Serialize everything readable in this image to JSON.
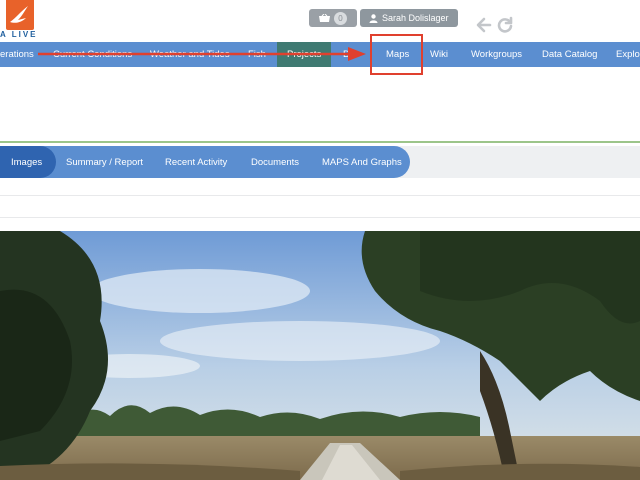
{
  "header": {
    "logo_text": "A LIVE",
    "cart": {
      "count": "0"
    },
    "user": {
      "name": "Sarah Dolislager"
    }
  },
  "main_nav": {
    "items": [
      {
        "label": "erations"
      },
      {
        "label": "Current Conditions"
      },
      {
        "label": "Weather and Tides"
      },
      {
        "label": "Fish"
      },
      {
        "label": "Projects"
      },
      {
        "label": "D"
      },
      {
        "label": "Maps"
      },
      {
        "label": "Wiki"
      },
      {
        "label": "Workgroups"
      },
      {
        "label": "Data Catalog"
      },
      {
        "label": "Explor"
      }
    ]
  },
  "sub_tabs": {
    "items": [
      {
        "label": "Images"
      },
      {
        "label": "Summary / Report"
      },
      {
        "label": "Recent Activity"
      },
      {
        "label": "Documents"
      },
      {
        "label": "MAPS And Graphs"
      }
    ]
  },
  "colors": {
    "nav_blue": "#5b8ed0",
    "active_tab": "#2f64b0",
    "projects_active": "#3f7a72",
    "annotation_red": "#e0402e",
    "logo_orange": "#e8622a"
  }
}
